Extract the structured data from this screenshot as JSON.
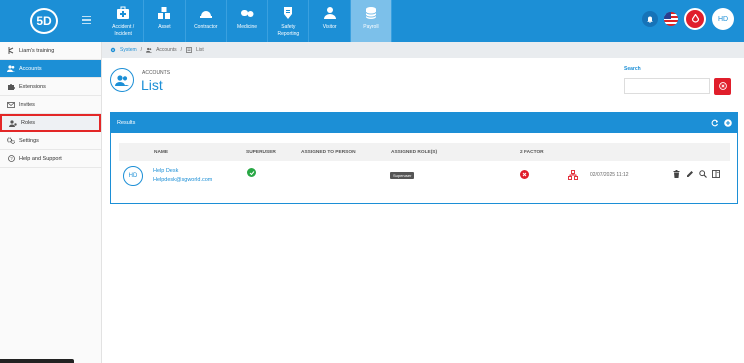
{
  "header": {
    "logo_text": "5D",
    "modules": [
      {
        "label": "Accident /\nIncident",
        "icon": "first-aid-kit-icon"
      },
      {
        "label": "Asset",
        "icon": "boxes-icon"
      },
      {
        "label": "Contractor",
        "icon": "hard-hat-icon"
      },
      {
        "label": "Medicine",
        "icon": "pills-icon"
      },
      {
        "label": "Safety\nReporting",
        "icon": "shield-report-icon"
      },
      {
        "label": "Visitor",
        "icon": "person-icon"
      },
      {
        "label": "Payroll",
        "icon": "coins-icon"
      }
    ],
    "active_module": "Payroll",
    "avatar_initials": "HD",
    "colors": {
      "primary": "#1c8fd6",
      "alert": "#e01e2b"
    }
  },
  "sidebar": {
    "items": [
      {
        "label": "Liam's training",
        "icon": "fork-icon"
      },
      {
        "label": "Accounts",
        "icon": "users-icon"
      },
      {
        "label": "Extensions",
        "icon": "puzzle-icon"
      },
      {
        "label": "Invites",
        "icon": "envelope-icon"
      },
      {
        "label": "Roles",
        "icon": "roles-icon"
      },
      {
        "label": "Settings",
        "icon": "gears-icon"
      },
      {
        "label": "Help and Support",
        "icon": "help-icon"
      }
    ],
    "active": "Accounts",
    "highlighted": "Roles"
  },
  "breadcrumb": {
    "items": [
      "System",
      "Accounts",
      "List"
    ],
    "separator": "/"
  },
  "page": {
    "supertitle": "ACCOUNTS",
    "title": "List",
    "search_label": "Search",
    "search_value": ""
  },
  "results": {
    "title": "Results",
    "columns": [
      "NAME",
      "SUPERUSER",
      "ASSIGNED TO PERSON",
      "ASSIGNED ROLE(S)",
      "2 FACTOR"
    ],
    "rows": [
      {
        "initials": "HD",
        "name": "Help Desk",
        "email": "Helpdesk@sgworld.com",
        "superuser": true,
        "assigned_to_person": "",
        "role": "Superuser",
        "two_factor": false,
        "date": "02/07/2025 11:12"
      }
    ]
  }
}
